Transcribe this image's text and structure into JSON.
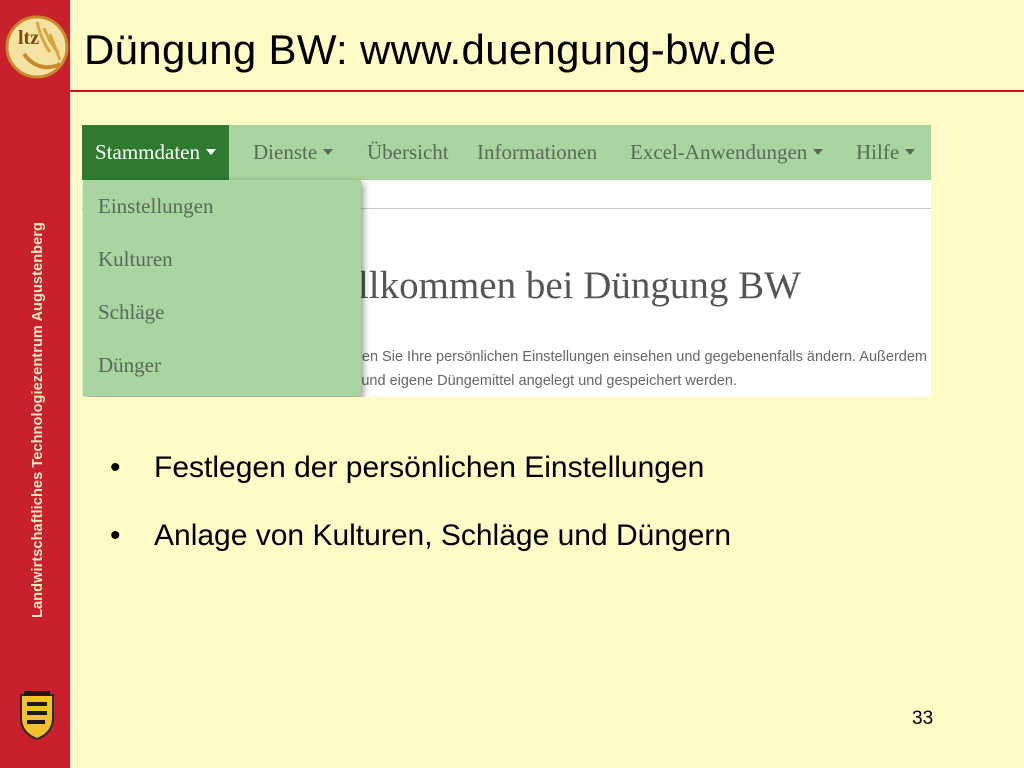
{
  "slide": {
    "title": "Düngung BW: www.duengung-bw.de",
    "sidebar_text": "Landwirtschaftliches Technologiezentrum Augustenberg",
    "logo_text": "ltz",
    "page_number": "33",
    "bullets": [
      "Festlegen der persönlichen Einstellungen",
      "Anlage von Kulturen, Schläge und Düngern"
    ]
  },
  "screenshot": {
    "nav": [
      {
        "label": "Stammdaten",
        "dropdown": true,
        "active": true
      },
      {
        "label": "Dienste",
        "dropdown": true,
        "active": false
      },
      {
        "label": "Übersicht",
        "dropdown": false,
        "active": false
      },
      {
        "label": "Informationen",
        "dropdown": false,
        "active": false
      },
      {
        "label": "Excel-Anwendungen",
        "dropdown": true,
        "active": false
      },
      {
        "label": "Hilfe",
        "dropdown": true,
        "active": false
      }
    ],
    "dropdown_items": [
      "Einstellungen",
      "Kulturen",
      "Schläge",
      "Dünger"
    ],
    "welcome_text": "Willkommen bei Düngung BW",
    "paragraph_line1": "Hier können Sie Ihre persönlichen Einstellungen einsehen und gegebenenfalls ändern. Außerdem",
    "paragraph_line2": "können Kulturen, Schläge und eigene Düngemittel angelegt und gespeichert werden."
  },
  "colors": {
    "background": "#fefbc6",
    "sidebar": "#c8202c",
    "nav_green": "#a9d5a0",
    "nav_active": "#2e7b30",
    "title_rule": "#c2151e"
  }
}
